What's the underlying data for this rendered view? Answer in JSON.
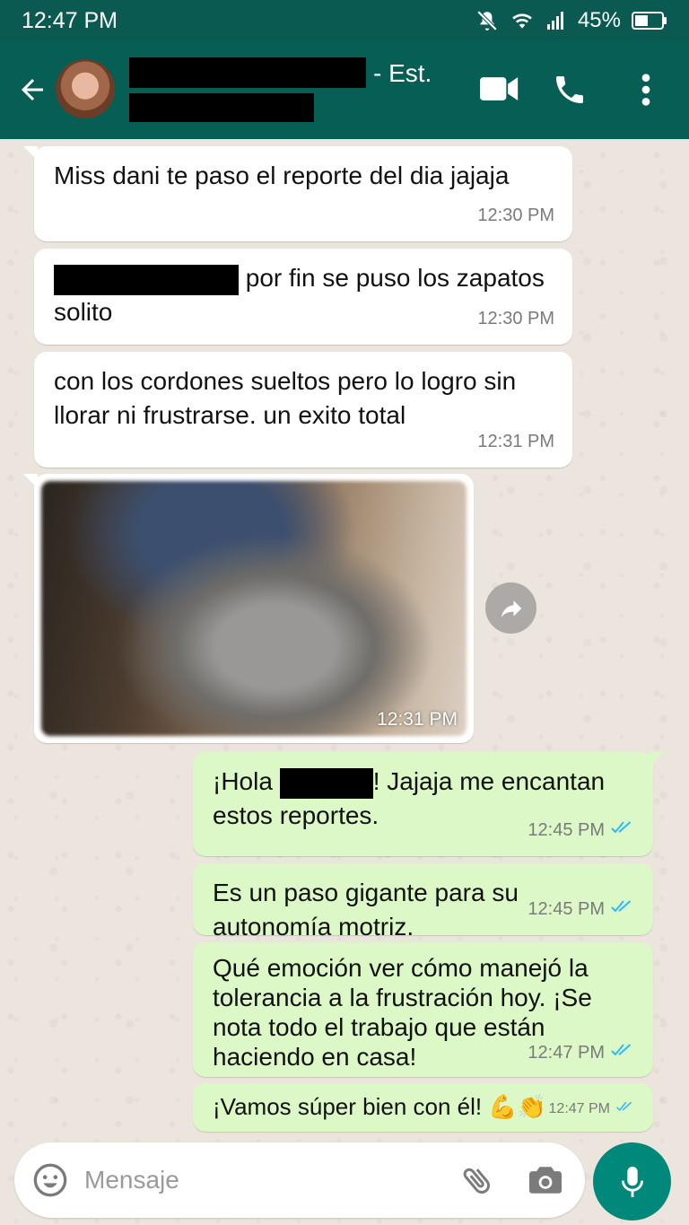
{
  "status_bar": {
    "time": "12:47 PM",
    "battery": "45%",
    "icons": [
      "mute-icon",
      "wifi-icon",
      "signal-icon",
      "battery-icon"
    ]
  },
  "header": {
    "contact_suffix": "- Est.",
    "icons": [
      "back-arrow-icon",
      "video-call-icon",
      "phone-icon",
      "more-vert-icon"
    ]
  },
  "messages": [
    {
      "direction": "in",
      "text": "Miss dani te paso el reporte del dia jajaja",
      "time": "12:30 PM"
    },
    {
      "direction": "in",
      "text_after_redaction": " por fin se puso los zapatos solito",
      "time": "12:30 PM"
    },
    {
      "direction": "in",
      "text": "con los cordones sueltos pero lo logro sin llorar ni frustrarse. un exito total",
      "time": "12:31 PM"
    },
    {
      "direction": "in",
      "type": "image",
      "time": "12:31 PM"
    },
    {
      "direction": "out",
      "text_before": "¡Hola ",
      "text_after": "! Jajaja me encantan estos reportes.",
      "time": "12:45 PM",
      "read": true
    },
    {
      "direction": "out",
      "text": "Es un paso gigante para su autonomía motriz.",
      "time": "12:45 PM",
      "read": true
    },
    {
      "direction": "out",
      "text": "Qué emoción ver cómo manejó la tolerancia a la frustración hoy. ¡Se nota todo el trabajo que están haciendo en casa!",
      "time": "12:47 PM",
      "read": true
    },
    {
      "direction": "out",
      "text": "¡Vamos súper bien con él! 💪👏",
      "time": "12:47 PM",
      "read": true
    }
  ],
  "composer": {
    "placeholder": "Mensaje",
    "icons": [
      "emoji-icon",
      "attach-icon",
      "camera-icon",
      "mic-icon"
    ]
  },
  "colors": {
    "header": "#075e54",
    "status_bar": "#0b5a52",
    "outgoing_bubble": "#dcf8c6",
    "incoming_bubble": "#ffffff",
    "wallpaper": "#ece5dd",
    "read_ticks": "#34b7f1",
    "mic_button": "#00897b"
  }
}
